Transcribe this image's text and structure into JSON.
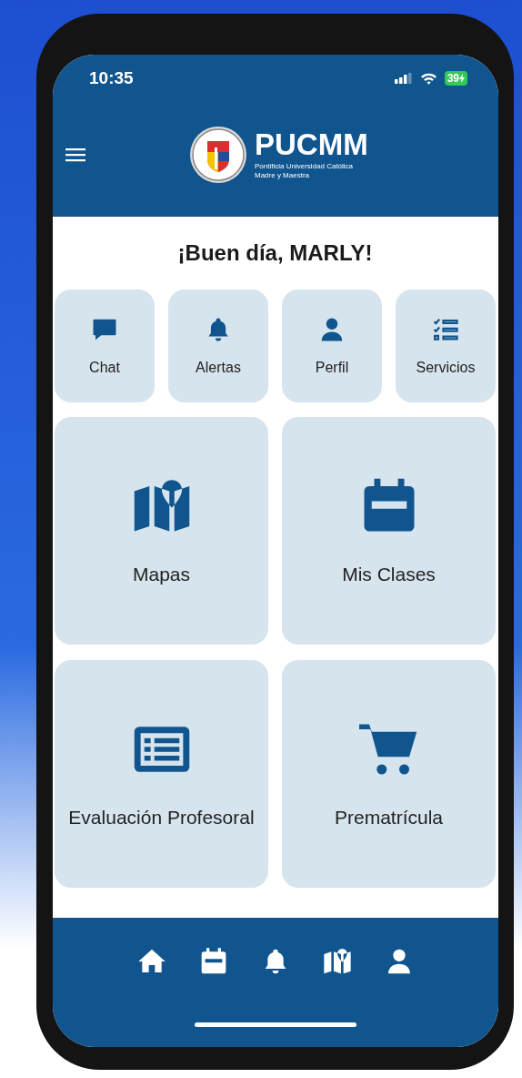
{
  "status_bar": {
    "time": "10:35",
    "battery": "39"
  },
  "header": {
    "title": "PUCMM",
    "subtitle_lines": [
      "Pontificia Universidad Católica",
      "Madre y Maestra"
    ]
  },
  "greeting": "¡Buen día, MARLY!",
  "shortcuts": [
    {
      "label": "Chat",
      "kind": "chat"
    },
    {
      "label": "Alertas",
      "kind": "bell"
    },
    {
      "label": "Perfil",
      "kind": "person"
    },
    {
      "label": "Servicios",
      "kind": "checklist"
    }
  ],
  "tiles": [
    {
      "label": "Mapas",
      "kind": "map"
    },
    {
      "label": "Mis Clases",
      "kind": "calendar"
    },
    {
      "label": "Evaluación Profesoral",
      "kind": "list"
    },
    {
      "label": "Prematrícula",
      "kind": "cart"
    }
  ],
  "bottom_nav": [
    {
      "kind": "home"
    },
    {
      "kind": "calendar"
    },
    {
      "kind": "bell"
    },
    {
      "kind": "map"
    },
    {
      "kind": "person"
    }
  ]
}
